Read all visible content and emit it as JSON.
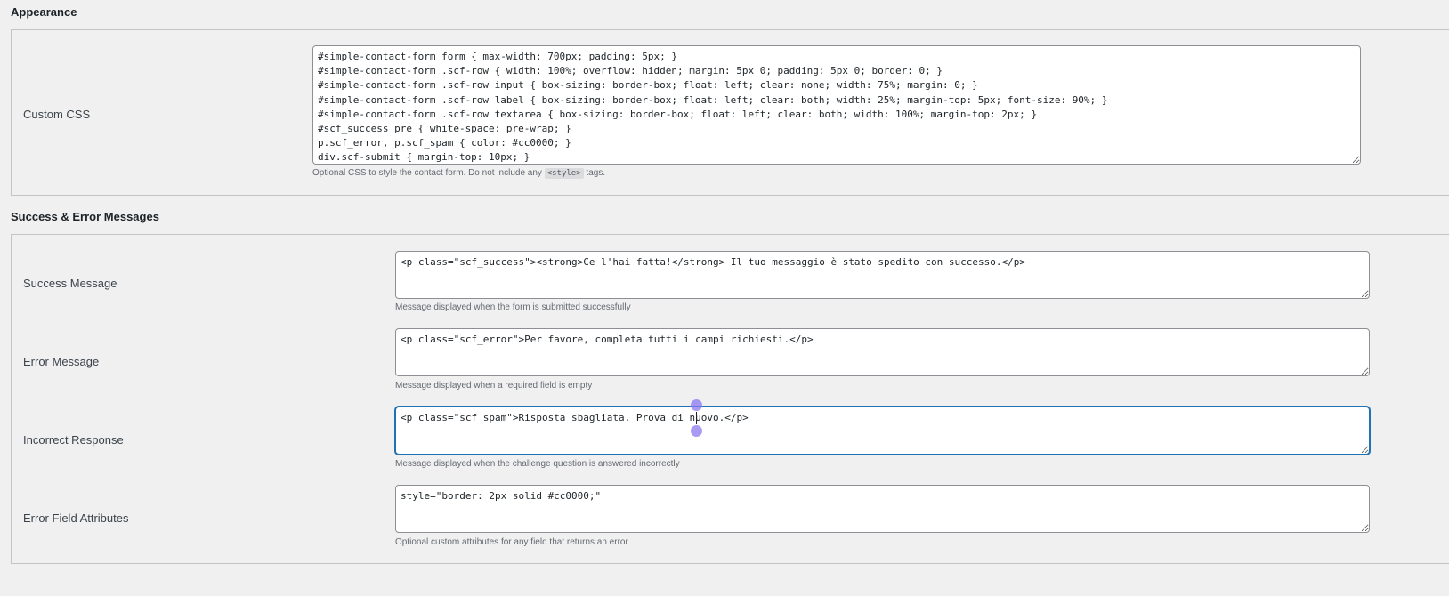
{
  "appearance": {
    "title": "Appearance",
    "custom_css": {
      "label": "Custom CSS",
      "value": "#simple-contact-form form { max-width: 700px; padding: 5px; }\n#simple-contact-form .scf-row { width: 100%; overflow: hidden; margin: 5px 0; padding: 5px 0; border: 0; }\n#simple-contact-form .scf-row input { box-sizing: border-box; float: left; clear: none; width: 75%; margin: 0; }\n#simple-contact-form .scf-row label { box-sizing: border-box; float: left; clear: both; width: 25%; margin-top: 5px; font-size: 90%; }\n#simple-contact-form .scf-row textarea { box-sizing: border-box; float: left; clear: both; width: 100%; margin-top: 2px; }\n#scf_success pre { white-space: pre-wrap; }\np.scf_error, p.scf_spam { color: #cc0000; }\ndiv.scf-submit { margin-top: 10px; }",
      "desc_before": "Optional CSS to style the contact form. Do not include any ",
      "desc_code": "<style>",
      "desc_after": " tags."
    }
  },
  "messages": {
    "title": "Success & Error Messages",
    "success": {
      "label": "Success Message",
      "value": "<p class=\"scf_success\"><strong>Ce l'hai fatta!</strong> Il tuo messaggio è stato spedito con successo.</p>",
      "desc": "Message displayed when the form is submitted successfully"
    },
    "error": {
      "label": "Error Message",
      "value": "<p class=\"scf_error\">Per favore, completa tutti i campi richiesti.</p>",
      "desc": "Message displayed when a required field is empty"
    },
    "incorrect": {
      "label": "Incorrect Response",
      "value": "<p class=\"scf_spam\">Risposta sbagliata. Prova di nuovo.</p>",
      "desc": "Message displayed when the challenge question is answered incorrectly"
    },
    "error_attrs": {
      "label": "Error Field Attributes",
      "value": "style=\"border: 2px solid #cc0000;\"",
      "desc": "Optional custom attributes for any field that returns an error"
    }
  },
  "colors": {
    "background": "#f0f0f1",
    "focus": "#2271b1",
    "selection_handle": "#8c78f0"
  }
}
